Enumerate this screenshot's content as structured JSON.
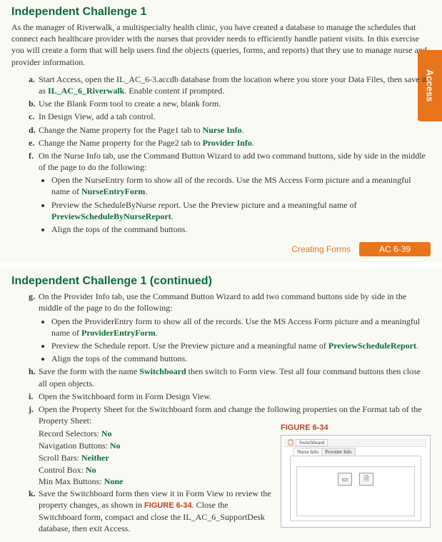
{
  "section1": {
    "heading": "Independent Challenge 1",
    "intro": "As the manager of Riverwalk, a multispecialty health clinic, you have created a database to manage the schedules that connect each healthcare provider with the nurses that provider needs to efficiently handle patient visits. In this exercise you will create a form that will help users find the objects (queries, forms, and reports) that they use to manage nurse and provider information.",
    "a_prefix": "Start Access, open the IL_AC_6-3.accdb database from the location where you store your Data Files, then save it as ",
    "a_bold": "IL_AC_6_Riverwalk",
    "a_suffix": ". Enable content if prompted.",
    "b": "Use the Blank Form tool to create a new, blank form.",
    "c": "In Design View, add a tab control.",
    "d_prefix": "Change the Name property for the Page1 tab to ",
    "d_bold": "Nurse Info",
    "d_suffix": ".",
    "e_prefix": "Change the Name property for the Page2 tab to ",
    "e_bold": "Provider Info",
    "e_suffix": ".",
    "f": "On the Nurse Info tab, use the Command Button Wizard to add two command buttons, side by side in the middle of the page to do the following:",
    "f1_prefix": "Open the NurseEntry form to show all of the records. Use the MS Access Form picture and a meaningful name of ",
    "f1_bold": "NurseEntryForm",
    "f1_suffix": ".",
    "f2_prefix": "Preview the ScheduleByNurse report. Use the Preview picture and a meaningful name of ",
    "f2_bold": "PreviewScheduleByNurseReport",
    "f2_suffix": ".",
    "f3": "Align the tops of the command buttons."
  },
  "sideTab": "Access",
  "footer": {
    "label": "Creating Forms",
    "page": "AC 6-39"
  },
  "section2": {
    "heading": "Independent Challenge 1 (continued)",
    "g": "On the Provider Info tab, use the Command Button Wizard to add two command buttons side by side in the middle of the page to do the following:",
    "g1_prefix": "Open the ProviderEntry form to show all of the records. Use the MS Access Form picture and a meaningful name of ",
    "g1_bold": "ProviderEntryForm",
    "g1_suffix": ".",
    "g2_prefix": "Preview the Schedule report. Use the Preview picture and a meaningful name of ",
    "g2_bold": "PreviewScheduleReport",
    "g2_suffix": ".",
    "g3": "Align the tops of the command buttons.",
    "h_prefix": "Save the form with the name ",
    "h_bold": "Switchboard",
    "h_suffix": " then switch to Form view. Test all four command buttons then close all open objects.",
    "i": "Open the Switchboard form in Form Design View.",
    "j": "Open the Property Sheet for the Switchboard form and change the following properties on the Format tab of the Property Sheet:",
    "props": {
      "p1l": "Record Selectors: ",
      "p1v": "No",
      "p2l": "Navigation Buttons: ",
      "p2v": "No",
      "p3l": "Scroll Bars: ",
      "p3v": "Neither",
      "p4l": "Control Box: ",
      "p4v": "No",
      "p5l": "Min Max Buttons: ",
      "p5v": "None"
    },
    "k_prefix": "Save the Switchboard form then view it in Form View to review the property changes, as shown in ",
    "k_fig": "FIGURE 6-34",
    "k_suffix": ". Close the Switchboard form, compact and close the IL_AC_6_SupportDesk database, then exit Access."
  },
  "figure": {
    "caption": "FIGURE 6-34",
    "title": "Switchboard",
    "tab1": "Nurse Info",
    "tab2": "Provider Info"
  }
}
